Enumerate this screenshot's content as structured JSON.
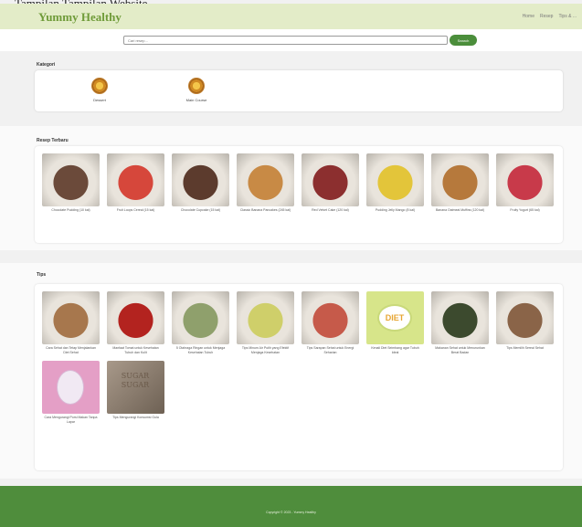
{
  "caption": "Tampilan Tampilan Website",
  "header": {
    "brand": "Yummy Healthy",
    "nav": [
      "Home",
      "Resep",
      "Tips & ..."
    ]
  },
  "search": {
    "placeholder": "Cari resep...",
    "button_label": "Search"
  },
  "kategori": {
    "title": "Kategori",
    "items": [
      {
        "label": "Dessert",
        "icon": "food-icon"
      },
      {
        "label": "Main Course",
        "icon": "food-icon"
      }
    ]
  },
  "resep": {
    "title": "Resep Terbaru",
    "items": [
      {
        "label": "Chocolate Pudding (10 kal)",
        "color": "#6b4a3a"
      },
      {
        "label": "Fruit Loops Cereal (15 kal)",
        "color": "#d6473b"
      },
      {
        "label": "Chocolate Cupcake (15 kal)",
        "color": "#5c3b2d"
      },
      {
        "label": "Classic Banana Pancakes (245 kal)",
        "color": "#c88a45"
      },
      {
        "label": "Red Velvet Cake (120 kal)",
        "color": "#8c2f2f"
      },
      {
        "label": "Pudding Jelly Mango (8 kal)",
        "color": "#e3c53a"
      },
      {
        "label": "Banana Oatmeal Muffins (120 kal)",
        "color": "#b6793c"
      },
      {
        "label": "Fruity Yogurt (65 kal)",
        "color": "#c83a4a"
      }
    ]
  },
  "tips": {
    "title": "Tips",
    "items": [
      {
        "label": "Cara Sehat dan Tetap Menjalankan Diet Sehat",
        "color": "#a7774d"
      },
      {
        "label": "Manfaat Tomat untuk Kesehatan Tubuh dan Kulit",
        "color": "#b3231f"
      },
      {
        "label": "5 Olahraga Ringan untuk Menjaga Kesehatan Tubuh",
        "color": "#8fa06c"
      },
      {
        "label": "Tips Minum Air Putih yang Efektif Menjaga Kesehatan",
        "color": "#cfcf6a"
      },
      {
        "label": "Tips Sarapan Sehat untuk Energi Seharian",
        "color": "#c65a4a"
      },
      {
        "label": "Kenali Diet Seimbang agar Tubuh Ideal",
        "color": "#d7e58a",
        "badge": "DIET"
      },
      {
        "label": "Makanan Sehat untuk Menurunkan Berat Badan",
        "color": "#3c4a2e"
      },
      {
        "label": "Tips Memilih Sereal Sehat",
        "color": "#8a6448"
      },
      {
        "label": "Cara Mengurangi Porsi Makan Tanpa Lapar",
        "color": "#e49fc6"
      },
      {
        "label": "Tips Mengurangi Konsumsi Gula",
        "color": "#8c7b69",
        "badge": "SUGAR"
      }
    ]
  },
  "footer": {
    "text": "Copyright © 2023 - Yummy Healthy"
  }
}
